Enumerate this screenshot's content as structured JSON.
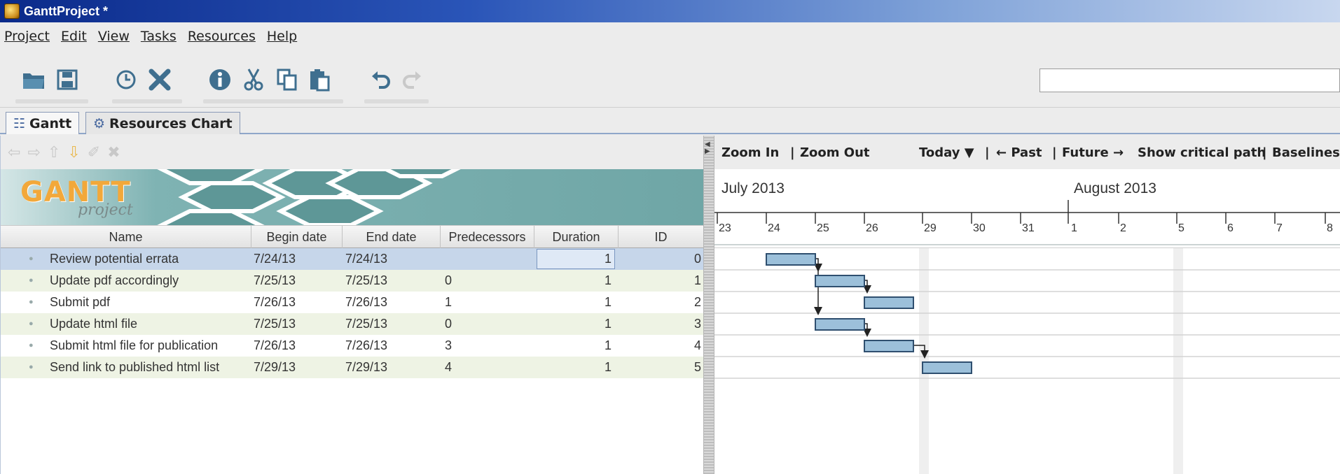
{
  "window": {
    "title": "GanttProject *"
  },
  "menu": [
    "Project",
    "Edit",
    "View",
    "Tasks",
    "Resources",
    "Help"
  ],
  "toolbar": {
    "icons": [
      "open-icon",
      "save-icon",
      "clock-icon",
      "delete-icon",
      "info-icon",
      "cut-icon",
      "copy-icon",
      "paste-icon",
      "undo-icon",
      "redo-icon"
    ],
    "search_value": ""
  },
  "tabs": [
    {
      "label": "Gantt",
      "icon": "gantt-tab-icon",
      "active": true
    },
    {
      "label": "Resources Chart",
      "icon": "resources-tab-icon",
      "active": false
    }
  ],
  "logo": {
    "main": "GANTT",
    "sub": "project"
  },
  "grid": {
    "columns": [
      "Name",
      "Begin date",
      "End date",
      "Predecessors",
      "Duration",
      "ID"
    ],
    "rows": [
      {
        "name": "Review potential errata",
        "begin": "7/24/13",
        "end": "7/24/13",
        "pred": "",
        "duration": "1",
        "id": "0"
      },
      {
        "name": "Update pdf accordingly",
        "begin": "7/25/13",
        "end": "7/25/13",
        "pred": "0",
        "duration": "1",
        "id": "1"
      },
      {
        "name": "Submit pdf",
        "begin": "7/26/13",
        "end": "7/26/13",
        "pred": "1",
        "duration": "1",
        "id": "2"
      },
      {
        "name": "Update html file",
        "begin": "7/25/13",
        "end": "7/25/13",
        "pred": "0",
        "duration": "1",
        "id": "3"
      },
      {
        "name": "Submit html file for publication",
        "begin": "7/26/13",
        "end": "7/26/13",
        "pred": "3",
        "duration": "1",
        "id": "4"
      },
      {
        "name": "Send link to published html list",
        "begin": "7/29/13",
        "end": "7/29/13",
        "pred": "4",
        "duration": "1",
        "id": "5"
      }
    ]
  },
  "chart_toolbar": {
    "zoom_in": "Zoom In",
    "sep1": "|",
    "zoom_out": "Zoom Out",
    "today": "Today ▼",
    "sep2": "|",
    "past": "← Past",
    "sep3": "|",
    "future": "Future →",
    "critical": "Show critical path",
    "sep4": "|",
    "baselines": "Baselines..."
  },
  "timeline": {
    "months": [
      "July 2013",
      "August 2013"
    ],
    "days": [
      "23",
      "24",
      "25",
      "26",
      "29",
      "30",
      "31",
      "1",
      "2",
      "5",
      "6",
      "7",
      "8"
    ]
  },
  "colors": {
    "bar_fill": "#9cc0da",
    "bar_stroke": "#2f4f6f",
    "selected_row": "#c6d6ea",
    "alt_row": "#eef3e4"
  }
}
